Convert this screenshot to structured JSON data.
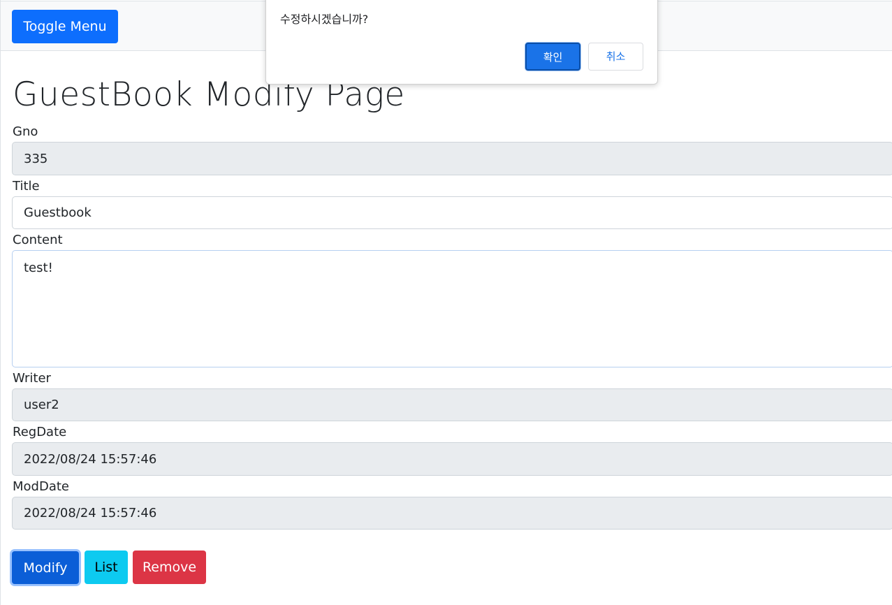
{
  "toolbar": {
    "toggle_label": "Toggle Menu"
  },
  "page": {
    "title": "GuestBook Modify Page"
  },
  "form": {
    "gno": {
      "label": "Gno",
      "value": "335"
    },
    "title": {
      "label": "Title",
      "value": "Guestbook"
    },
    "content": {
      "label": "Content",
      "value": "test!"
    },
    "writer": {
      "label": "Writer",
      "value": "user2"
    },
    "regdate": {
      "label": "RegDate",
      "value": "2022/08/24 15:57:46"
    },
    "moddate": {
      "label": "ModDate",
      "value": "2022/08/24 15:57:46"
    }
  },
  "actions": {
    "modify_label": "Modify",
    "list_label": "List",
    "remove_label": "Remove"
  },
  "dialog": {
    "message": "수정하시겠습니까?",
    "ok_label": "확인",
    "cancel_label": "취소"
  },
  "colors": {
    "primary": "#0d6efd",
    "info": "#0dcaf0",
    "danger": "#dc3545",
    "readonly_bg": "#e9ecef"
  }
}
